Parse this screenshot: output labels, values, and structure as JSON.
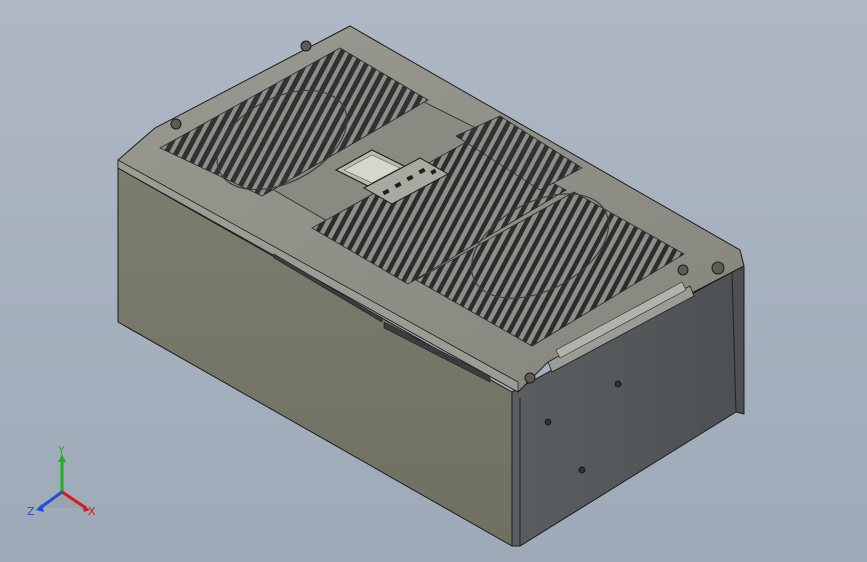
{
  "model": {
    "display_text": "",
    "keypad_text": "",
    "colors": {
      "housing_top": "#8c8c84",
      "housing_front": "#777868",
      "housing_side": "#555a5a",
      "vents": "#2f3233",
      "outline": "#1c1c1c"
    }
  },
  "triad": {
    "labels": {
      "x": "X",
      "y": "Y",
      "z": "Z"
    },
    "colors": {
      "x": "#d81b1b",
      "y": "#20b020",
      "z": "#1f4fd8"
    }
  }
}
